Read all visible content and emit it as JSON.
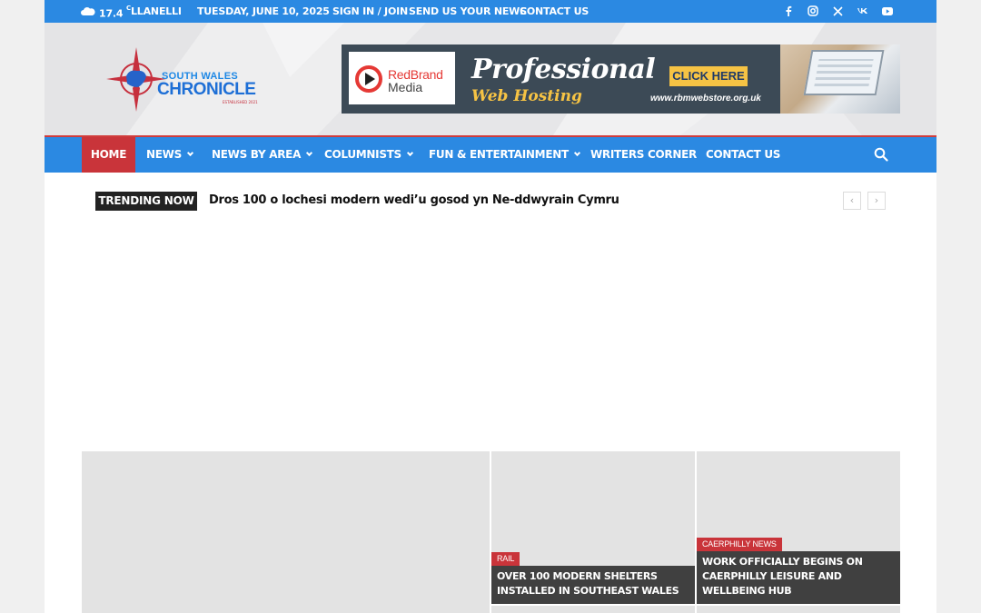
{
  "topbar": {
    "weather_icon": "cloud-icon",
    "temperature": "17.4",
    "temp_unit": "C",
    "location": "LLANELLI",
    "date": "TUESDAY, JUNE 10, 2025",
    "links": [
      "SIGN IN / JOIN",
      "SEND US YOUR NEWS",
      "CONTACT US"
    ],
    "social": [
      "facebook-icon",
      "instagram-icon",
      "x-icon",
      "vk-icon",
      "youtube-icon"
    ]
  },
  "logo": {
    "line1": "SOUTH WALES",
    "line2": "CHRONICLE",
    "tagline": "ESTABLISHED 2021"
  },
  "banner": {
    "brand_top": "RedBrand",
    "brand_bottom": "Media",
    "headline": "Professional",
    "subheadline": "Web Hosting",
    "cta": "CLICK HERE",
    "url": "www.rbmwebstore.org.uk"
  },
  "nav": {
    "items": [
      {
        "label": "HOME",
        "dropdown": false,
        "active": true
      },
      {
        "label": "NEWS",
        "dropdown": true
      },
      {
        "label": "NEWS BY AREA",
        "dropdown": true
      },
      {
        "label": "COLUMNISTS",
        "dropdown": true
      },
      {
        "label": "FUN & ENTERTAINMENT",
        "dropdown": true
      },
      {
        "label": "WRITERS CORNER",
        "dropdown": false
      },
      {
        "label": "CONTACT US",
        "dropdown": false
      }
    ],
    "search_icon": "search-icon"
  },
  "trending": {
    "label": "TRENDING NOW",
    "headline": "Dros 100 o lochesi modern wedi’u gosod yn Ne-ddwyrain Cymru",
    "prev_icon": "chevron-left-icon",
    "next_icon": "chevron-right-icon"
  },
  "featured": [
    {
      "category": "RAIL",
      "title": "OVER 100 MODERN SHELTERS INSTALLED IN SOUTHEAST WALES"
    },
    {
      "category": "CAERPHILLY NEWS",
      "title": "WORK OFFICIALLY BEGINS ON CAERPHILLY LEISURE AND WELLBEING HUB"
    }
  ],
  "colors": {
    "primary_blue": "#2b89e2",
    "accent_red": "#c9343a",
    "dark": "#222222"
  }
}
